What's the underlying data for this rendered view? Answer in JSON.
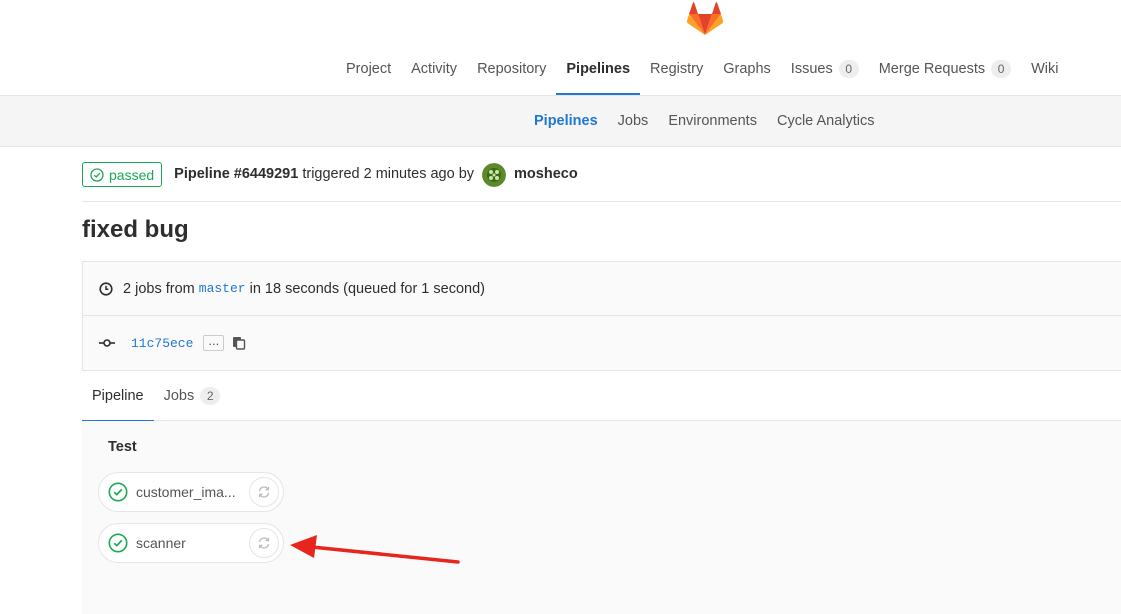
{
  "top_nav": {
    "items": [
      {
        "label": "Project"
      },
      {
        "label": "Activity"
      },
      {
        "label": "Repository"
      },
      {
        "label": "Pipelines",
        "active": true
      },
      {
        "label": "Registry"
      },
      {
        "label": "Graphs"
      },
      {
        "label": "Issues",
        "badge": "0"
      },
      {
        "label": "Merge Requests",
        "badge": "0"
      },
      {
        "label": "Wiki"
      }
    ]
  },
  "sub_nav": {
    "items": [
      {
        "label": "Pipelines",
        "active": true
      },
      {
        "label": "Jobs"
      },
      {
        "label": "Environments"
      },
      {
        "label": "Cycle Analytics"
      }
    ]
  },
  "pipeline": {
    "status": "passed",
    "title": "Pipeline #6449291",
    "triggered_text": "triggered 2 minutes ago by",
    "user": "mosheco"
  },
  "commit": {
    "message": "fixed bug",
    "jobs_text_before": "2 jobs from",
    "branch": "master",
    "jobs_text_after": "in 18 seconds (queued for 1 second)",
    "sha": "11c75ece",
    "ellipsis": "..."
  },
  "tabs": [
    {
      "label": "Pipeline",
      "active": true
    },
    {
      "label": "Jobs",
      "badge": "2"
    }
  ],
  "stage": {
    "name": "Test",
    "jobs": [
      {
        "name": "customer_ima..."
      },
      {
        "name": "scanner"
      }
    ]
  },
  "colors": {
    "success": "#1aaa55",
    "link": "#1f78d1",
    "annotation_arrow": "#e8251d"
  },
  "icons": [
    "gitlab-logo-icon",
    "check-circle-icon",
    "clock-icon",
    "commit-icon",
    "clipboard-icon",
    "retry-icon",
    "annotation-arrow"
  ]
}
